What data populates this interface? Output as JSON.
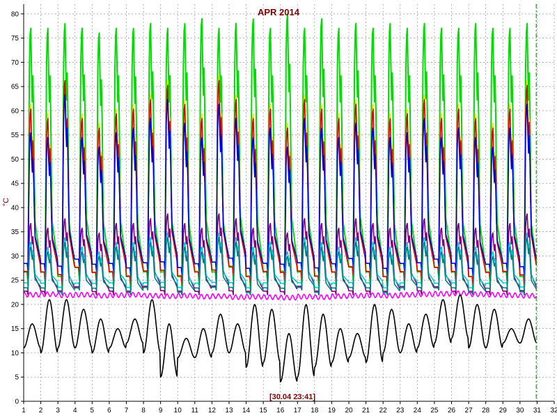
{
  "chart_data": {
    "type": "line",
    "title": "APR 2014",
    "ylabel": "°C",
    "xlabel": "",
    "timestamp": "[30.04 23:41]",
    "xlim": [
      1,
      32
    ],
    "ylim": [
      0,
      82
    ],
    "x_ticks": [
      "1",
      "2",
      "3",
      "4",
      "5",
      "6",
      "7",
      "8",
      "9",
      "10",
      "11",
      "12",
      "13",
      "14",
      "15",
      "16",
      "17",
      "18",
      "19",
      "20",
      "21",
      "22",
      "23",
      "24",
      "25",
      "26",
      "27",
      "28",
      "29",
      "30",
      "31",
      "32"
    ],
    "y_ticks": [
      "0",
      "5",
      "10",
      "15",
      "20",
      "25",
      "30",
      "35",
      "40",
      "45",
      "50",
      "55",
      "60",
      "65",
      "70",
      "75",
      "80"
    ],
    "grid": true,
    "colors": {
      "title": "#800000",
      "axis": "#000000",
      "grid": "#808080",
      "marker_line": "#008000"
    },
    "current_time_marker_x": 30.95,
    "series": [
      {
        "color": "#00dd00",
        "day_max": [
          78,
          78,
          79,
          78,
          77,
          78,
          78,
          79,
          78,
          79,
          80,
          78,
          79,
          80,
          78,
          81,
          78,
          80,
          78,
          79,
          78,
          79,
          78,
          79,
          78,
          78,
          79,
          78,
          78,
          79
        ],
        "day_min": [
          24,
          24,
          23,
          25,
          24,
          24,
          23,
          24,
          24,
          23,
          24,
          24,
          25,
          23,
          24,
          24,
          24,
          23,
          24,
          25,
          24,
          23,
          24,
          24,
          25,
          24,
          23,
          24,
          24,
          23
        ]
      },
      {
        "color": "#ffdd00",
        "day_max": [
          62,
          60,
          66,
          60,
          58,
          61,
          62,
          64,
          67,
          63,
          60,
          68,
          64,
          60,
          62,
          58,
          64,
          62,
          60,
          63,
          62,
          60,
          61,
          64,
          60,
          62,
          60,
          58,
          62,
          67
        ],
        "day_min": [
          25,
          25,
          24,
          26,
          25,
          25,
          24,
          25,
          25,
          24,
          25,
          25,
          26,
          24,
          25,
          25,
          25,
          24,
          25,
          26,
          25,
          24,
          25,
          25,
          26,
          25,
          24,
          25,
          25,
          24
        ]
      },
      {
        "color": "#dd0000",
        "day_max": [
          61,
          59,
          67,
          59,
          57,
          60,
          61,
          63,
          66,
          62,
          59,
          67,
          63,
          59,
          61,
          57,
          63,
          61,
          59,
          62,
          61,
          59,
          60,
          63,
          59,
          61,
          59,
          57,
          61,
          66
        ],
        "day_min": [
          25,
          25,
          24,
          26,
          25,
          25,
          24,
          25,
          25,
          24,
          25,
          25,
          26,
          24,
          25,
          25,
          25,
          24,
          25,
          26,
          25,
          24,
          25,
          25,
          26,
          25,
          24,
          25,
          25,
          24
        ]
      },
      {
        "color": "#0000dd",
        "day_max": [
          56,
          55,
          64,
          55,
          53,
          56,
          57,
          59,
          63,
          58,
          55,
          62,
          59,
          55,
          57,
          53,
          59,
          57,
          55,
          58,
          57,
          55,
          56,
          59,
          55,
          57,
          55,
          53,
          57,
          62
        ],
        "day_min": [
          27,
          27,
          26,
          28,
          27,
          27,
          26,
          27,
          27,
          26,
          27,
          27,
          28,
          26,
          27,
          27,
          27,
          26,
          27,
          28,
          27,
          26,
          27,
          27,
          28,
          27,
          26,
          27,
          27,
          26
        ]
      },
      {
        "color": "#800080",
        "day_max": [
          37,
          36,
          38,
          36,
          35,
          37,
          37,
          38,
          39,
          37,
          36,
          39,
          38,
          36,
          37,
          35,
          38,
          37,
          36,
          38,
          37,
          36,
          37,
          38,
          36,
          37,
          36,
          35,
          37,
          39
        ],
        "day_min": [
          22,
          22,
          22,
          23,
          22,
          22,
          22,
          23,
          22,
          22,
          22,
          23,
          22,
          22,
          22,
          22,
          23,
          22,
          22,
          22,
          22,
          22,
          23,
          22,
          23,
          22,
          22,
          22,
          22,
          22
        ]
      },
      {
        "color": "#00cccc",
        "day_max": [
          33,
          32,
          34,
          32,
          31,
          33,
          33,
          34,
          35,
          33,
          32,
          35,
          34,
          32,
          33,
          31,
          34,
          33,
          32,
          34,
          33,
          32,
          33,
          34,
          32,
          33,
          32,
          31,
          33,
          35
        ],
        "day_min": [
          24,
          24,
          23,
          24,
          24,
          24,
          23,
          24,
          24,
          23,
          24,
          24,
          24,
          23,
          24,
          24,
          24,
          23,
          24,
          24,
          24,
          23,
          24,
          24,
          24,
          24,
          23,
          24,
          24,
          23
        ]
      },
      {
        "color": "#008080",
        "day_max": [
          32,
          31,
          33,
          31,
          30,
          32,
          32,
          33,
          34,
          32,
          31,
          34,
          33,
          31,
          32,
          30,
          33,
          32,
          31,
          33,
          32,
          31,
          32,
          33,
          31,
          32,
          31,
          30,
          32,
          34
        ],
        "day_min": [
          23,
          23,
          22,
          23,
          23,
          23,
          22,
          23,
          23,
          22,
          23,
          23,
          23,
          22,
          23,
          23,
          23,
          22,
          23,
          23,
          23,
          22,
          23,
          23,
          23,
          23,
          22,
          23,
          23,
          22
        ]
      },
      {
        "color": "#ff00ff",
        "day_max": [
          22.5,
          22.6,
          22.4,
          22.5,
          22.3,
          22.4,
          22.5,
          22.3,
          22.2,
          22.3,
          22.1,
          22.2,
          22.0,
          22.1,
          22.0,
          21.9,
          22.1,
          22.0,
          22.2,
          22.3,
          22.4,
          22.3,
          22.5,
          22.6,
          22.7,
          22.8,
          22.6,
          22.5,
          22.4,
          22.3
        ],
        "day_min": [
          21.5,
          21.6,
          21.4,
          21.5,
          21.3,
          21.4,
          21.5,
          21.3,
          21.2,
          21.3,
          21.1,
          21.2,
          21.0,
          21.1,
          21.0,
          20.9,
          21.1,
          21.0,
          21.2,
          21.3,
          21.4,
          21.3,
          21.5,
          21.6,
          21.7,
          21.8,
          21.6,
          21.5,
          21.4,
          21.3
        ]
      },
      {
        "color": "#000000",
        "day_max": [
          16,
          21,
          21,
          19,
          17,
          15,
          17,
          21,
          16,
          13,
          15,
          18,
          16,
          20,
          19,
          14,
          20,
          18,
          15,
          14,
          20,
          19,
          16,
          18,
          21,
          22,
          20,
          19,
          15,
          17
        ],
        "day_min": [
          11,
          10,
          11,
          11,
          10,
          11,
          12,
          10,
          5,
          9,
          9,
          10,
          10,
          7,
          8,
          4,
          5,
          7,
          8,
          9,
          8,
          10,
          10,
          11,
          12,
          13,
          11,
          11,
          12,
          12
        ]
      }
    ]
  }
}
